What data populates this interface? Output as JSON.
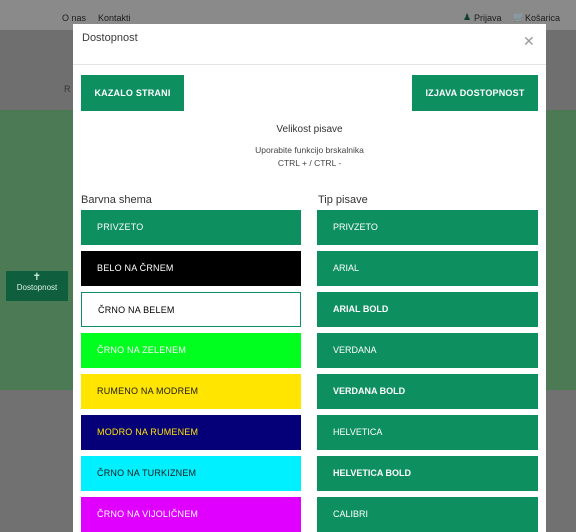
{
  "topbar": {
    "about": "O nas",
    "contacts": "Kontakti",
    "login": "Prijava",
    "cart": "Košarica"
  },
  "side": {
    "accessibility_label": "Dostopnost"
  },
  "nav": {
    "partial_letter": "R"
  },
  "modal": {
    "title": "Dostopnost",
    "close": "✕",
    "sitemap_button": "KAZALO STRANI",
    "statement_button": "IZJAVA DOSTOPNOST",
    "font_size_title": "Velikost pisave",
    "font_size_hint": "Uporabite funkcijo brskalnika",
    "font_size_keys": "CTRL + / CTRL -",
    "color_scheme_title": "Barvna shema",
    "font_type_title": "Tip pisave",
    "color_schemes": [
      {
        "label": "PRIVZETO",
        "bg": "#0e8f5f",
        "fg": "#ffffff"
      },
      {
        "label": "BELO NA ČRNEM",
        "bg": "#000000",
        "fg": "#ffffff"
      },
      {
        "label": "ČRNO NA BELEM",
        "bg": "#ffffff",
        "fg": "#000000"
      },
      {
        "label": "ČRNO NA ZELENEM",
        "bg": "#00ff1e",
        "fg": "#ffffff"
      },
      {
        "label": "RUMENO NA MODREM",
        "bg": "#ffe500",
        "fg": "#1a1a1a"
      },
      {
        "label": "MODRO NA RUMENEM",
        "bg": "#050078",
        "fg": "#ffe500"
      },
      {
        "label": "ČRNO NA TURKIZNEM",
        "bg": "#00f0ff",
        "fg": "#1a1a1a"
      },
      {
        "label": "ČRNO NA VIJOLIČNEM",
        "bg": "#e000ff",
        "fg": "#ffffff"
      }
    ],
    "font_types": [
      "PRIVZETO",
      "ARIAL",
      "ARIAL BOLD",
      "VERDANA",
      "VERDANA BOLD",
      "HELVETICA",
      "HELVETICA BOLD",
      "CALIBRI"
    ]
  }
}
